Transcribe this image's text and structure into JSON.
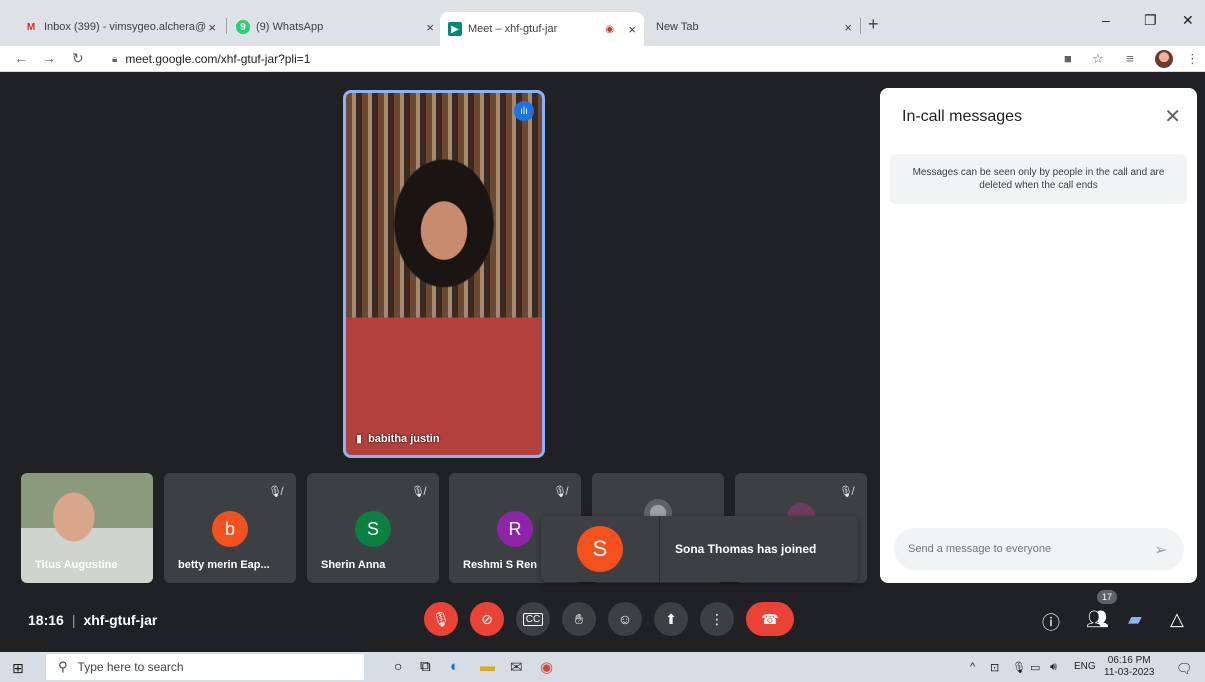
{
  "browser": {
    "tabs": [
      {
        "title": "Inbox (399) - vimsygeo.alchera@",
        "icon": "gmail-icon",
        "color": "#d93025"
      },
      {
        "title": "(9) WhatsApp",
        "icon": "whatsapp-icon",
        "color": "#25d366"
      },
      {
        "title": "Meet – xhf-gtuf-jar",
        "icon": "meet-icon",
        "color": "#00897b"
      },
      {
        "title": "New Tab",
        "icon": "",
        "color": ""
      }
    ],
    "tab_close": "×",
    "new_tab": "+",
    "url": "meet.google.com/xhf-gtuf-jar?pli=1",
    "window_controls": {
      "minimize": "–",
      "restore": "❐",
      "close": "✕"
    }
  },
  "meet": {
    "main_speaker": {
      "name": "babitha justin"
    },
    "tiles": [
      {
        "name": "Titus Augustine",
        "type": "video"
      },
      {
        "name": "betty merin Eap...",
        "initial": "b",
        "color": "#f4511e"
      },
      {
        "name": "Sherin Anna",
        "initial": "S",
        "color": "#0b8043"
      },
      {
        "name": "Reshmi S Ren",
        "initial": "R",
        "color": "#8e24aa"
      },
      {
        "name": "",
        "initial": "",
        "color": ""
      },
      {
        "name": "",
        "initial": "",
        "color": ""
      }
    ],
    "toast": {
      "initial": "S",
      "message": "Sona Thomas has joined"
    },
    "time": "18:16",
    "separator": "|",
    "meeting_code": "xhf-gtuf-jar",
    "people_count": "17",
    "chat": {
      "title": "In-call messages",
      "notice": "Messages can be seen only by people in the call and are deleted when the call ends",
      "placeholder": "Send a message to everyone"
    }
  },
  "taskbar": {
    "search_placeholder": "Type here to search",
    "language": "ENG",
    "time": "06:16 PM",
    "date": "11-03-2023"
  },
  "colors": {
    "accent": "#8ab4f8",
    "danger": "#ea4335",
    "background": "#202124"
  }
}
